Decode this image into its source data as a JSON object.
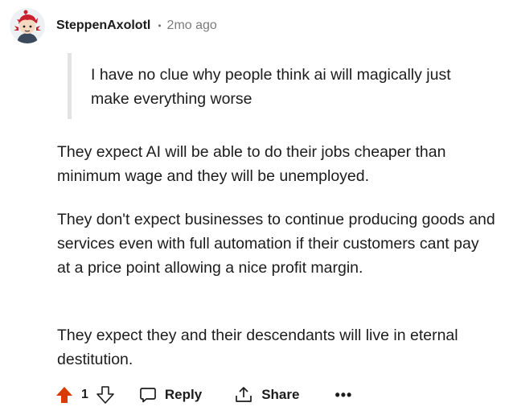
{
  "comment": {
    "username": "SteppenAxolotl",
    "separator": "•",
    "time": "2mo ago",
    "quote": "I have no clue why people think ai will magically just make everything worse",
    "paragraphs": [
      "They expect AI will be able to do their jobs cheaper than minimum wage and they will be unemployed.",
      "They don't expect businesses to continue producing goods and services even with full automation if their customers cant pay at a price point allowing a nice profit margin.",
      "They expect they and their descendants will live in eternal destitution."
    ]
  },
  "actions": {
    "score": "1",
    "reply_label": "Reply",
    "share_label": "Share",
    "more_label": "•••"
  },
  "icons": {
    "upvote": "upvote-arrow-icon",
    "downvote": "downvote-arrow-icon",
    "reply": "speech-bubble-icon",
    "share": "share-icon",
    "more": "more-dots-icon"
  },
  "colors": {
    "upvote_active": "#d93a00",
    "meta_gray": "#7c7c7c",
    "quote_bar": "#e3e3e3",
    "text": "#1c1c1c"
  }
}
